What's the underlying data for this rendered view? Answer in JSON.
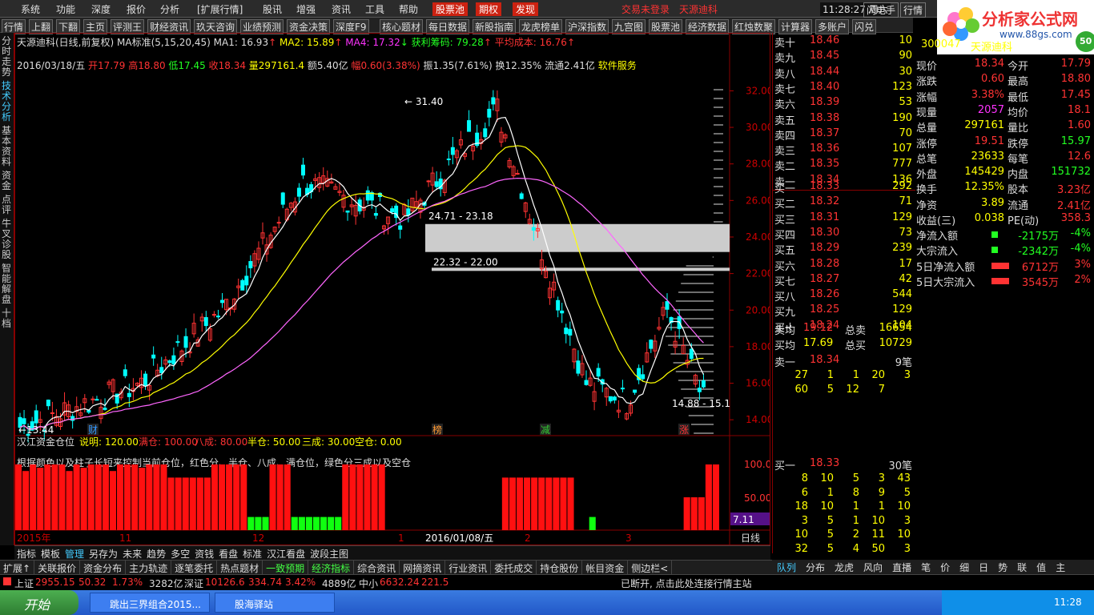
{
  "menubar": {
    "items": [
      "系统",
      "功能",
      "深度",
      "报价",
      "分析",
      "[扩展行情]",
      "股讯",
      "增强",
      "资讯",
      "工具",
      "帮助"
    ],
    "red_buttons": [
      "股票池",
      "期权",
      "发现"
    ],
    "warnings": [
      "交易未登录",
      "天源迪科"
    ],
    "clock": "11:28:27 周六",
    "right_buttons": [
      "闪电手",
      "行情"
    ]
  },
  "toolbar": {
    "items": [
      "行情",
      "上翻",
      "下翻",
      "主页",
      "评测王",
      "财经资讯",
      "玖天咨询",
      "业绩预测",
      "资金决策",
      "深度F9",
      "核心题材",
      "每日数据",
      "新股指南",
      "龙虎榜单",
      "沪深指数",
      "九宫图",
      "股票池",
      "经济数据",
      "红烛数聚",
      "计算器",
      "多账户",
      "闪兑"
    ]
  },
  "leftnav": [
    "分时走势",
    "技术分析",
    "基本资料",
    "资金",
    "点评",
    "牛叉诊股",
    "智能解盘",
    "十档"
  ],
  "leftnav_active": "技术分析",
  "chart_header": {
    "title": "天源迪科(日线,前复权)",
    "ma_label": "MA标准(5,15,20,45)",
    "ma1": "MA1: 16.93",
    "ma2": "MA2: 15.89",
    "ma4": "MA4: 17.32",
    "profit": "获利筹码: 79.28",
    "avgcost": "平均成本: 16.76"
  },
  "ohlc": {
    "date": "2016/03/18/五",
    "open": "开17.79",
    "high": "高18.80",
    "low": "低17.45",
    "close": "收18.34",
    "vol": "量297161.4",
    "amt": "额5.40亿",
    "change": "幅0.60(3.38%)",
    "amp": "振1.35(7.61%)",
    "turnover": "换12.35%",
    "float": "流通2.41亿",
    "sector": "软件服务"
  },
  "price_axis": [
    "32.00",
    "30.00",
    "28.00",
    "26.00",
    "24.00",
    "22.00",
    "20.00",
    "18.00",
    "16.00",
    "14.00"
  ],
  "annotations": {
    "high_label": "31.40",
    "low_label": "13.44",
    "gap1": "24.71 - 23.18",
    "gap2": "22.32 - 22.00",
    "recent_low": "14.88 - 15.1"
  },
  "event_markers": [
    "财",
    "榜",
    "减",
    "涨"
  ],
  "sub_indicator": {
    "title": "汉江资金仓位",
    "desc": "说明: 120.00",
    "full": "满仓: 100.00",
    "eighty": "八成: 80.00",
    "half": "半仓: 50.00",
    "thirty": "三成: 30.00",
    "empty": "空仓: 0.00",
    "note": "根据颜色以及柱子长短来控制当前仓位，红色分、半仓、八成、满仓位，绿色分三成以及空仓",
    "axis": [
      "100.0",
      "50.00"
    ],
    "last": "7.11"
  },
  "time_axis": [
    "2015年",
    "11",
    "12",
    "1",
    "2016/01/08/五",
    "2",
    "3"
  ],
  "period": "日线",
  "bottom_tabs": [
    "指标",
    "模板",
    "管理",
    "另存为",
    "未来",
    "趋势",
    "多空",
    "资钱",
    "看盘",
    "标准",
    "汉江看盘",
    "波段主图"
  ],
  "bottom_tabs_active": "管理",
  "ext_tabs": [
    "扩展↑",
    "关联报价",
    "资金分布",
    "主力轨迹",
    "逐笔委托",
    "热点题材",
    "一致预期",
    "经济指标",
    "综合资讯",
    "网摘资讯",
    "行业资讯",
    "委托成交",
    "持仓股份",
    "帐目资金",
    "侧边栏<"
  ],
  "ob_tabs": [
    "队列",
    "分布",
    "龙虎",
    "风向",
    "直播",
    "笔",
    "价",
    "细",
    "日",
    "势",
    "联",
    "值",
    "主"
  ],
  "orderbook": {
    "asks": [
      {
        "label": "卖十",
        "price": "18.46",
        "vol": "10"
      },
      {
        "label": "卖九",
        "price": "18.45",
        "vol": "90"
      },
      {
        "label": "卖八",
        "price": "18.44",
        "vol": "30"
      },
      {
        "label": "卖七",
        "price": "18.40",
        "vol": "123"
      },
      {
        "label": "卖六",
        "price": "18.39",
        "vol": "53"
      },
      {
        "label": "卖五",
        "price": "18.38",
        "vol": "190"
      },
      {
        "label": "卖四",
        "price": "18.37",
        "vol": "70"
      },
      {
        "label": "卖三",
        "price": "18.36",
        "vol": "107"
      },
      {
        "label": "卖二",
        "price": "18.35",
        "vol": "777"
      },
      {
        "label": "卖一",
        "price": "18.34",
        "vol": "136"
      }
    ],
    "bids": [
      {
        "label": "买一",
        "price": "18.33",
        "vol": "292"
      },
      {
        "label": "买二",
        "price": "18.32",
        "vol": "71"
      },
      {
        "label": "买三",
        "price": "18.31",
        "vol": "129"
      },
      {
        "label": "买四",
        "price": "18.30",
        "vol": "73"
      },
      {
        "label": "买五",
        "price": "18.29",
        "vol": "239"
      },
      {
        "label": "买六",
        "price": "18.28",
        "vol": "17"
      },
      {
        "label": "买七",
        "price": "18.27",
        "vol": "42"
      },
      {
        "label": "买八",
        "price": "18.26",
        "vol": "544"
      },
      {
        "label": "买九",
        "price": "18.25",
        "vol": "129"
      },
      {
        "label": "买十",
        "price": "18.24",
        "vol": "104"
      }
    ],
    "avg_sell": {
      "label": "卖均",
      "price": "19.12",
      "tlabel": "总卖",
      "tvol": "16654"
    },
    "avg_buy": {
      "label": "买均",
      "price": "17.69",
      "tlabel": "总买",
      "tvol": "10729"
    },
    "sell1_queue": {
      "label": "卖一",
      "price": "18.34",
      "count": "9笔",
      "rows": [
        [
          "27",
          "1",
          "1",
          "20",
          "3"
        ],
        [
          "60",
          "5",
          "12",
          "7",
          ""
        ]
      ]
    },
    "buy1_queue": {
      "label": "买一",
      "price": "18.33",
      "count": "30笔",
      "rows": [
        [
          "8",
          "10",
          "5",
          "3",
          "43"
        ],
        [
          "6",
          "1",
          "8",
          "9",
          "5"
        ],
        [
          "18",
          "10",
          "1",
          "1",
          "10"
        ],
        [
          "3",
          "5",
          "1",
          "10",
          "3"
        ],
        [
          "10",
          "5",
          "2",
          "11",
          "10"
        ],
        [
          "32",
          "5",
          "4",
          "50",
          "3"
        ]
      ]
    }
  },
  "quote": {
    "code": "300047",
    "name": "天源迪科",
    "rows": [
      {
        "l1": "现价",
        "v1": "18.34",
        "l2": "今开",
        "v2": "17.79"
      },
      {
        "l1": "涨跌",
        "v1": "0.60",
        "l2": "最高",
        "v2": "18.80"
      },
      {
        "l1": "涨幅",
        "v1": "3.38%",
        "l2": "最低",
        "v2": "17.45"
      },
      {
        "l1": "现量",
        "v1": "2057",
        "l2": "均价",
        "v2": "18.1"
      },
      {
        "l1": "总量",
        "v1": "297161",
        "l2": "量比",
        "v2": "1.60"
      },
      {
        "l1": "涨停",
        "v1": "19.51",
        "l2": "跌停",
        "v2": "15.97"
      },
      {
        "l1": "总笔",
        "v1": "23633",
        "l2": "每笔",
        "v2": "12.6"
      },
      {
        "l1": "外盘",
        "v1": "145429",
        "l2": "内盘",
        "v2": "151732"
      },
      {
        "l1": "换手",
        "v1": "12.35%",
        "l2": "股本",
        "v2": "3.23亿"
      },
      {
        "l1": "净资",
        "v1": "3.89",
        "l2": "流通",
        "v2": "2.41亿"
      },
      {
        "l1": "收益(三)",
        "v1": "0.038",
        "l2": "PE(动)",
        "v2": "358.3"
      }
    ],
    "flows": [
      {
        "label": "净流入额",
        "val": "-2175万",
        "pct": "-4%"
      },
      {
        "label": "大宗流入",
        "val": "-2342万",
        "pct": "-4%"
      },
      {
        "label": "5日净流入额",
        "val": "6712万",
        "pct": "3%"
      },
      {
        "label": "5日大宗流入",
        "val": "3545万",
        "pct": "2%"
      }
    ]
  },
  "status": {
    "sh_label": "上证",
    "sh": "2955.15",
    "sh_chg": "50.32",
    "sh_pct": "1.73%",
    "sh_amt": "3282亿",
    "sz_label": "深证",
    "sz": "10126.6",
    "sz_chg": "334.74",
    "sz_pct": "3.42%",
    "sz_amt": "4889亿",
    "zx_label": "中小",
    "zx": "6632.24",
    "zx_chg": "221.5",
    "conn": "已断开, 点击此处连接行情主站"
  },
  "logo": {
    "text": "分析家公式网",
    "url": "www.88gs.com",
    "badge": "50"
  },
  "taskbar": {
    "start": "开始",
    "tasks": [
      "跳出三界组合2015...",
      "股海驿站"
    ],
    "time": "11:28"
  },
  "chart_data": {
    "type": "candlestick",
    "y_range": [
      13,
      32.5
    ],
    "high": 31.4,
    "low": 13.44,
    "last_close": 18.34
  },
  "colors": {
    "up": "#ff3333",
    "down": "#00ffff",
    "ma1": "#ffffff",
    "ma2": "#ffff00",
    "ma4": "#ff66ff",
    "grid": "#800000"
  }
}
